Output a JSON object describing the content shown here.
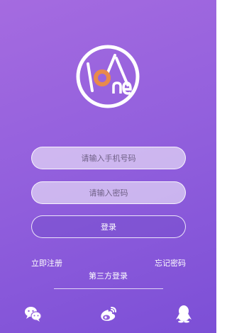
{
  "form": {
    "phone_placeholder": "请输入手机号码",
    "password_placeholder": "请输入密码",
    "login_label": "登录"
  },
  "links": {
    "register": "立即注册",
    "forgot_password": "忘记密码"
  },
  "third_party": {
    "label": "第三方登录",
    "providers": [
      "wechat-icon",
      "weibo-icon",
      "qq-icon"
    ]
  },
  "colors": {
    "background_top": "#a56be0",
    "background_bottom": "#7c4fd6",
    "logo_accent": "#e98a4b"
  }
}
